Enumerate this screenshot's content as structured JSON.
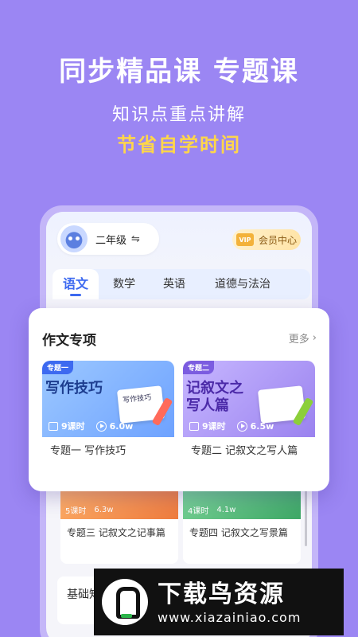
{
  "hero": {
    "title": "同步精品课 专题课",
    "subtitle": "知识点重点讲解",
    "highlight": "节省自学时间"
  },
  "header": {
    "grade": "二年级",
    "swap_icon": "⇋",
    "vip_badge": "VIP",
    "vip_label": "会员中心"
  },
  "tabs": [
    {
      "label": "语文",
      "active": true
    },
    {
      "label": "数学",
      "active": false
    },
    {
      "label": "英语",
      "active": false
    },
    {
      "label": "道德与法治",
      "active": false
    }
  ],
  "background_cards": [
    {
      "lessons": "5课时",
      "plays": "6.3w",
      "title": "专题三 记叙文之记事篇"
    },
    {
      "lessons": "4课时",
      "plays": "4.1w",
      "title": "专题四 记叙文之写景篇"
    }
  ],
  "basic_section": {
    "label": "基础知"
  },
  "popup": {
    "title": "作文专项",
    "more": "更多",
    "more_icon": "›",
    "topics": [
      {
        "tag": "专题一",
        "thumb_title": "写作技巧",
        "book_text": "写作技巧",
        "lessons": "9课时",
        "plays": "6.0w",
        "name": "专题一 写作技巧"
      },
      {
        "tag": "专题二",
        "thumb_title_line1": "记叙文之",
        "thumb_title_line2": "写人篇",
        "lessons": "9课时",
        "plays": "6.5w",
        "name": "专题二 记叙文之写人篇"
      }
    ]
  },
  "watermark": {
    "name": "下载鸟资源",
    "url": "www.xiazainiao.com"
  },
  "colors": {
    "background": "#9b86f3",
    "accent_yellow": "#ffd64a",
    "accent_blue": "#3d6af0"
  }
}
